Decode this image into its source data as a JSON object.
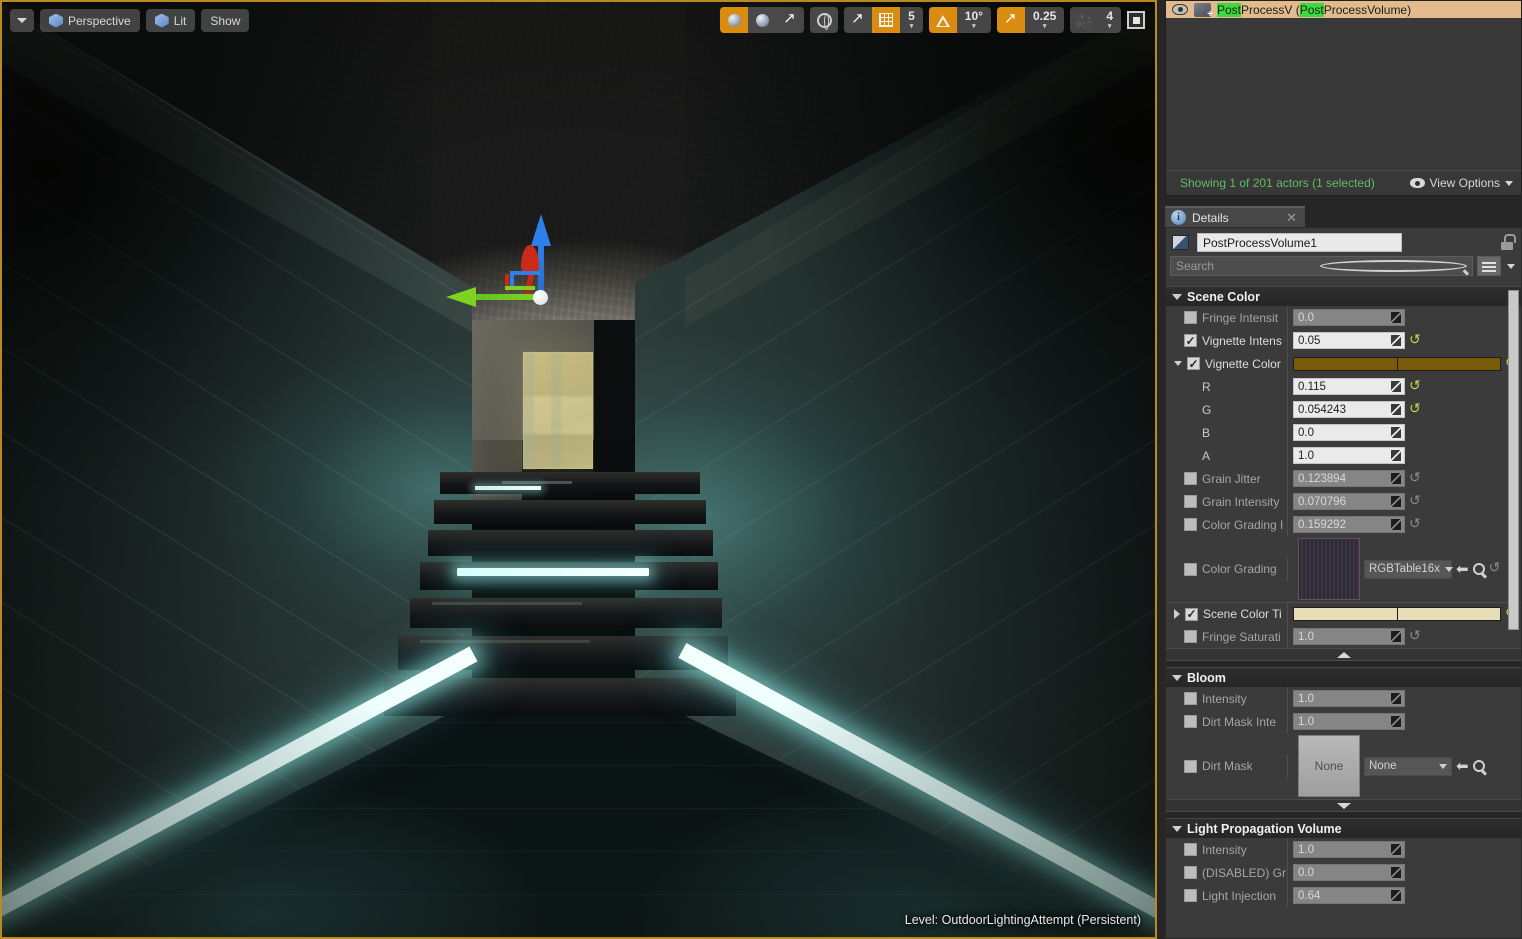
{
  "viewport": {
    "toolbar_left": [
      {
        "name": "viewport-menu",
        "label": ""
      },
      {
        "name": "perspective",
        "label": "Perspective"
      },
      {
        "name": "view-mode",
        "label": "Lit"
      },
      {
        "name": "show-menu",
        "label": "Show"
      }
    ],
    "toolbar_right": {
      "translate_icon": "move-gizmo-icon",
      "rotate_icon": "rotate-gizmo-icon",
      "scale_icon": "scale-gizmo-icon",
      "coord_icon": "world-coordinate-icon",
      "surface_snap_icon": "surface-snapping-icon",
      "grid_snap_icon": "grid-snap-icon",
      "grid_value": "5",
      "angle_snap_icon": "angle-snap-icon",
      "angle_value": "10°",
      "scale_snap_icon": "scale-snap-icon",
      "scale_value": "0.25",
      "camera_speed_icon": "camera-speed-icon",
      "camera_speed_value": "4",
      "maximize_icon": "maximize-viewport-icon"
    },
    "level_status": "Level:  OutdoorLightingAttempt (Persistent)"
  },
  "outliner": {
    "row": {
      "prefix": "Post",
      "mid": "ProcessV",
      "paren_open": " (",
      "hl2": "Post",
      "rest": "ProcessVolume)"
    },
    "status": "Showing 1 of 201 actors (1 selected)",
    "view_options": "View Options"
  },
  "details": {
    "tab_label": "Details",
    "actor_name": "PostProcessVolume1",
    "search_placeholder": "Search",
    "categories": [
      {
        "name": "Scene Color",
        "title": "Scene Color",
        "rows": [
          {
            "label": "Fringe Intensit",
            "value": "0.0",
            "enabled": false,
            "checked": false,
            "kind": "num",
            "revert": false,
            "indent": 1
          },
          {
            "label": "Vignette Intens",
            "value": "0.05",
            "enabled": true,
            "checked": true,
            "kind": "num",
            "revert": true,
            "indent": 1
          },
          {
            "label": "Vignette Color",
            "value": "",
            "enabled": true,
            "checked": true,
            "kind": "color",
            "color": "#7a5a08",
            "revert": true,
            "indent": 1,
            "expander": "down"
          },
          {
            "label": "R",
            "value": "0.115",
            "enabled": true,
            "checked": null,
            "kind": "num",
            "revert": true,
            "indent": 3
          },
          {
            "label": "G",
            "value": "0.054243",
            "enabled": true,
            "checked": null,
            "kind": "num",
            "revert": true,
            "indent": 3
          },
          {
            "label": "B",
            "value": "0.0",
            "enabled": true,
            "checked": null,
            "kind": "num",
            "revert": false,
            "indent": 3
          },
          {
            "label": "A",
            "value": "1.0",
            "enabled": true,
            "checked": null,
            "kind": "num",
            "revert": false,
            "indent": 3
          },
          {
            "label": "Grain Jitter",
            "value": "0.123894",
            "enabled": false,
            "checked": false,
            "kind": "num",
            "revert": true,
            "indent": 1
          },
          {
            "label": "Grain Intensity",
            "value": "0.070796",
            "enabled": false,
            "checked": false,
            "kind": "num",
            "revert": true,
            "indent": 1
          },
          {
            "label": "Color Grading I",
            "value": "0.159292",
            "enabled": false,
            "checked": false,
            "kind": "num",
            "revert": true,
            "indent": 1
          }
        ],
        "lut_row": {
          "label": "Color Grading",
          "asset_name": "RGBTable16x",
          "thumb_name": "color-grading-lut-thumbnail"
        },
        "tail_rows": [
          {
            "label": "Scene Color Ti",
            "value": "",
            "enabled": true,
            "checked": true,
            "kind": "color",
            "color": "#e7ddb6",
            "revert": true,
            "indent": 1,
            "expander": "right"
          },
          {
            "label": "Fringe Saturati",
            "value": "1.0",
            "enabled": false,
            "checked": false,
            "kind": "num",
            "revert": true,
            "indent": 1
          }
        ]
      },
      {
        "name": "Bloom",
        "title": "Bloom",
        "rows": [
          {
            "label": "Intensity",
            "value": "1.0",
            "enabled": false,
            "checked": false,
            "kind": "num",
            "revert": false,
            "indent": 1
          },
          {
            "label": "Dirt Mask Inte",
            "value": "1.0",
            "enabled": false,
            "checked": false,
            "kind": "num",
            "revert": false,
            "indent": 1
          }
        ],
        "asset_row": {
          "label": "Dirt Mask",
          "thumb_label": "None",
          "asset_name": "None"
        }
      },
      {
        "name": "Light Propagation Volume",
        "title": "Light Propagation Volume",
        "rows": [
          {
            "label": "Intensity",
            "value": "1.0",
            "enabled": false,
            "checked": false,
            "kind": "num",
            "revert": false,
            "indent": 1
          },
          {
            "label": "(DISABLED) Gr",
            "value": "0.0",
            "enabled": false,
            "checked": false,
            "kind": "num",
            "revert": false,
            "indent": 1
          },
          {
            "label": "Light Injection",
            "value": "0.64",
            "enabled": false,
            "checked": false,
            "kind": "num",
            "revert": false,
            "indent": 1
          }
        ]
      }
    ]
  },
  "colors": {
    "accent_orange": "#d98c10",
    "viewport_border": "#b88a22",
    "panel_bg": "#3b3b3b",
    "status_green": "#5fbd63",
    "selection_row": "#e2bb8c"
  }
}
